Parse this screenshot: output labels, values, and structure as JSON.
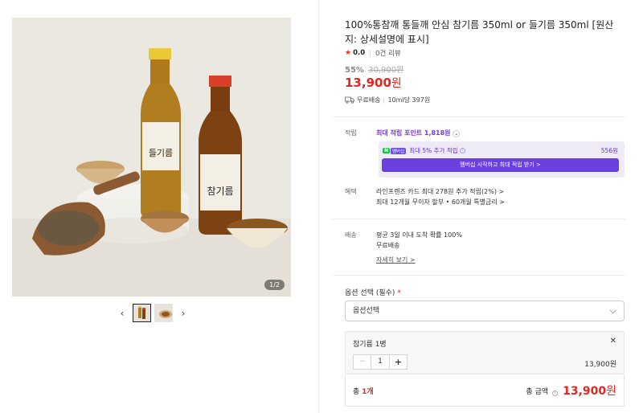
{
  "gallery": {
    "page_indicator": "1/2",
    "thumbs": [
      "product-bottles-thumb",
      "product-cup-thumb"
    ]
  },
  "product": {
    "title": "100%통참깨 통들깨 안심 참기름 350ml or 들기름 350ml [원산지: 상세설명에 표시]",
    "rating": "0.0",
    "reviews": "0건 리뷰",
    "discount_rate": "55%",
    "original_price": "30,900원",
    "price": "13,900",
    "price_unit": "원",
    "shipping": "무료배송",
    "unit_price": "10ml당 397원"
  },
  "points": {
    "label": "적립",
    "link": "최대 적립 포인트 1,818원",
    "membership_n": "N",
    "membership_badge": "멤버십",
    "extra_text": "최대 5% 추가 적립",
    "extra_amount": "556원",
    "button": "멤버십 시작하고 최대 적립 받기 >"
  },
  "benefits": {
    "label": "혜택",
    "line1": "라인프렌즈 카드 최대 278원 추가 적립(2%) >",
    "line2": "최대 12개월 무이자 할부 • 60개월 특별금리 >"
  },
  "delivery": {
    "label": "배송",
    "line1": "평균 3일 이내 도착 확률 100%",
    "line2": "무료배송",
    "details": "자세히 보기 >"
  },
  "options": {
    "label": "옵션 선택 (필수)",
    "required_mark": "*",
    "select_placeholder": "옵션선택",
    "selected_name": "참기름 1병",
    "quantity": "1",
    "line_price": "13,900원"
  },
  "total": {
    "count_prefix": "총 ",
    "count": "1개",
    "label": "총 금액",
    "price": "13,900",
    "unit": "원"
  }
}
